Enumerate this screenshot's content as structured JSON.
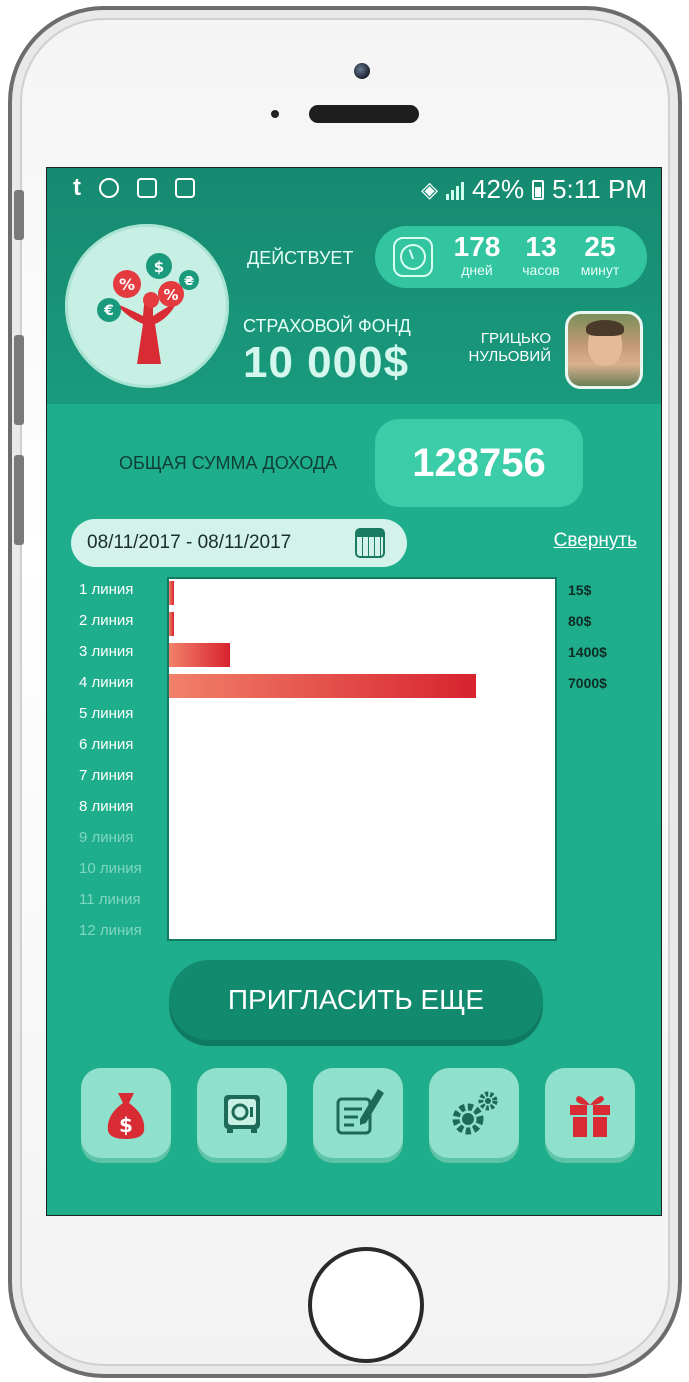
{
  "status_bar": {
    "battery": "42%",
    "time": "5:11 PM"
  },
  "header": {
    "active_label": "ДЕЙСТВУЕТ",
    "timer": {
      "days_value": "178",
      "days_unit": "дней",
      "hours_value": "13",
      "hours_unit": "часов",
      "minutes_value": "25",
      "minutes_unit": "минут"
    },
    "fund_label": "СТРАХОВОЙ ФОНД",
    "fund_value": "10 000$",
    "user_name_first": "ГРИЦЬКО",
    "user_name_last": "НУЛЬОВИЙ"
  },
  "income": {
    "label": "ОБЩАЯ СУММА ДОХОДА",
    "value": "128756"
  },
  "date_range": "08/11/2017 - 08/11/2017",
  "collapse_link": "Свернуть",
  "chart_data": {
    "type": "bar",
    "orientation": "horizontal",
    "categories": [
      "1 линия",
      "2 линия",
      "3 линия",
      "4 линия",
      "5 линия",
      "6 линия",
      "7 линия",
      "8 линия",
      "9 линия",
      "10 линия",
      "11 линия",
      "12 линия"
    ],
    "values": [
      15,
      80,
      1400,
      7000,
      0,
      0,
      0,
      0,
      0,
      0,
      0,
      0
    ],
    "value_labels": [
      "15$",
      "80$",
      "1400$",
      "7000$"
    ],
    "xlim": [
      0,
      8800
    ]
  },
  "invite_button": "ПРИГЛАСИТЬ ЕЩЕ",
  "colors": {
    "primary": "#1fae8c",
    "header": "#168a70",
    "bar_start": "#f2806a",
    "bar_end": "#d7232e"
  },
  "nav_icons": [
    "money-bag-icon",
    "safe-icon",
    "contract-icon",
    "gears-icon",
    "gift-icon"
  ]
}
